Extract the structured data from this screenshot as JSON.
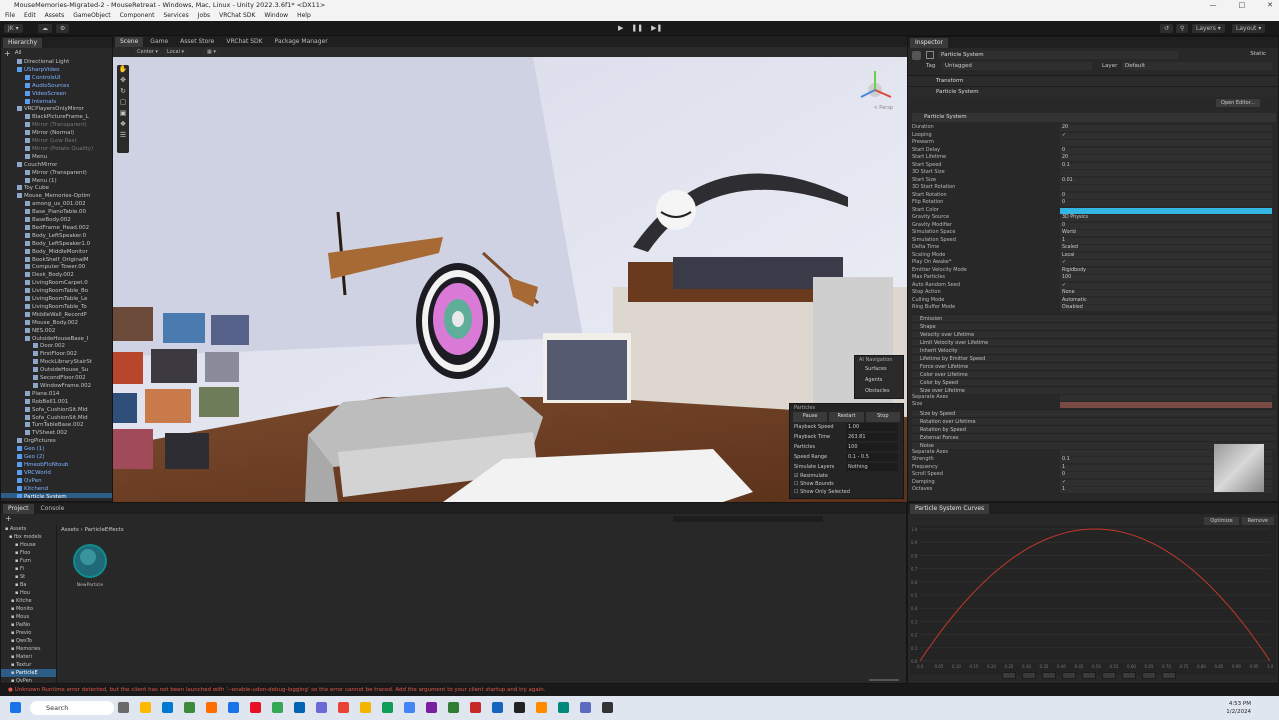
{
  "window": {
    "title": "MouseMemories-Migrated-2 - MouseRetreat - Windows, Mac, Linux - Unity 2022.3.6f1* <DX11>"
  },
  "menu": [
    "File",
    "Edit",
    "Assets",
    "GameObject",
    "Component",
    "Services",
    "Jobs",
    "VRChat SDK",
    "Window",
    "Help"
  ],
  "toolbar": {
    "account": "JK",
    "layers": "Layers",
    "layout": "Layout"
  },
  "hierarchy": {
    "tab": "Hierarchy",
    "search_label": "All",
    "items": [
      {
        "label": "Directional Light",
        "indent": 2,
        "style": "normal"
      },
      {
        "label": "USharpVideo",
        "indent": 2,
        "style": "blue"
      },
      {
        "label": "ControlsUI",
        "indent": 4,
        "style": "blue"
      },
      {
        "label": "AudioSources",
        "indent": 4,
        "style": "blue"
      },
      {
        "label": "VideoScreen",
        "indent": 4,
        "style": "blue"
      },
      {
        "label": "Internals",
        "indent": 4,
        "style": "blue"
      },
      {
        "label": "VRCPlayersOnlyMirror",
        "indent": 2,
        "style": "normal"
      },
      {
        "label": "BlackPictureFrame_L",
        "indent": 4,
        "style": "normal"
      },
      {
        "label": "Mirror (Transparent)",
        "indent": 4,
        "style": "dim"
      },
      {
        "label": "Mirror (Normal)",
        "indent": 4,
        "style": "normal"
      },
      {
        "label": "Mirror (Low Res)",
        "indent": 4,
        "style": "dim"
      },
      {
        "label": "Mirror (Potato Quality)",
        "indent": 4,
        "style": "dim"
      },
      {
        "label": "Menu",
        "indent": 4,
        "style": "normal"
      },
      {
        "label": "CouchMirror",
        "indent": 2,
        "style": "normal"
      },
      {
        "label": "Mirror (Transparent)",
        "indent": 4,
        "style": "normal"
      },
      {
        "label": "Menu (1)",
        "indent": 4,
        "style": "normal"
      },
      {
        "label": "Toy Cube",
        "indent": 2,
        "style": "normal"
      },
      {
        "label": "Mouse_Memories-Optim",
        "indent": 2,
        "style": "normal"
      },
      {
        "label": "among_us_001.002",
        "indent": 4,
        "style": "normal"
      },
      {
        "label": "Base_PianoTable.00",
        "indent": 4,
        "style": "normal"
      },
      {
        "label": "BaseBody.002",
        "indent": 4,
        "style": "normal"
      },
      {
        "label": "BedFrame_Head.002",
        "indent": 4,
        "style": "normal"
      },
      {
        "label": "Body_LeftSpeaker.0",
        "indent": 4,
        "style": "normal"
      },
      {
        "label": "Body_LeftSpeaker1.0",
        "indent": 4,
        "style": "normal"
      },
      {
        "label": "Body_MiddleMonitor",
        "indent": 4,
        "style": "normal"
      },
      {
        "label": "BookShelf_OriginalM",
        "indent": 4,
        "style": "normal"
      },
      {
        "label": "Computer Tower.00",
        "indent": 4,
        "style": "normal"
      },
      {
        "label": "Desk_Body.002",
        "indent": 4,
        "style": "normal"
      },
      {
        "label": "LivingRoomCarpet.0",
        "indent": 4,
        "style": "normal"
      },
      {
        "label": "LivingRoomTable_Bo",
        "indent": 4,
        "style": "normal"
      },
      {
        "label": "LivingRoomTable_Le",
        "indent": 4,
        "style": "normal"
      },
      {
        "label": "LivingRoomTable_To",
        "indent": 4,
        "style": "normal"
      },
      {
        "label": "MiddleWall_RecordP",
        "indent": 4,
        "style": "normal"
      },
      {
        "label": "Mouse_Body.002",
        "indent": 4,
        "style": "normal"
      },
      {
        "label": "NES.002",
        "indent": 4,
        "style": "normal"
      },
      {
        "label": "OutsideHouseBase_I",
        "indent": 4,
        "style": "normal"
      },
      {
        "label": "Door.002",
        "indent": 6,
        "style": "normal"
      },
      {
        "label": "FirstFloor.002",
        "indent": 6,
        "style": "normal"
      },
      {
        "label": "MockLibraryStairSt",
        "indent": 6,
        "style": "normal"
      },
      {
        "label": "OutsideHouse_Su",
        "indent": 6,
        "style": "normal"
      },
      {
        "label": "SecondFloor.002",
        "indent": 6,
        "style": "normal"
      },
      {
        "label": "WindowFrame.002",
        "indent": 6,
        "style": "normal"
      },
      {
        "label": "Plane.014",
        "indent": 4,
        "style": "normal"
      },
      {
        "label": "RobBell1.001",
        "indent": 4,
        "style": "normal"
      },
      {
        "label": "Sofa_CushionSit.Mid",
        "indent": 4,
        "style": "normal"
      },
      {
        "label": "Sofa_CushionSit.Mid",
        "indent": 4,
        "style": "normal"
      },
      {
        "label": "TurnTableBase.002",
        "indent": 4,
        "style": "normal"
      },
      {
        "label": "TVSheet.002",
        "indent": 4,
        "style": "normal"
      },
      {
        "label": "OrgPictures",
        "indent": 2,
        "style": "normal"
      },
      {
        "label": "Geo (1)",
        "indent": 2,
        "style": "blue"
      },
      {
        "label": "Geo (2)",
        "indent": 2,
        "style": "blue"
      },
      {
        "label": "HmeobFloNtoub",
        "indent": 2,
        "style": "blue"
      },
      {
        "label": "VRCWorld",
        "indent": 2,
        "style": "blue"
      },
      {
        "label": "QvPen",
        "indent": 2,
        "style": "blue"
      },
      {
        "label": "Kitchend",
        "indent": 2,
        "style": "blue"
      },
      {
        "label": "Particle System",
        "indent": 2,
        "style": "selected"
      }
    ]
  },
  "scene": {
    "tabs": [
      "Scene",
      "Game",
      "Asset Store",
      "VRChat SDK",
      "Package Manager"
    ],
    "active_tab": "Scene",
    "pivot": "Center",
    "space": "Local",
    "persp_label": "< Persp",
    "ai_nav": {
      "title": "AI Navigation",
      "items": [
        "Surfaces",
        "Agents",
        "Obstacles"
      ]
    },
    "particles_overlay": {
      "title": "Particles",
      "buttons": [
        "Pause",
        "Restart",
        "Stop"
      ],
      "rows": [
        {
          "label": "Playback Speed",
          "value": "1.00"
        },
        {
          "label": "Playback Time",
          "value": "263.81"
        },
        {
          "label": "Particles",
          "value": "100"
        },
        {
          "label": "Speed Range",
          "value": "0.1 - 0.5"
        },
        {
          "label": "Simulate Layers",
          "value": "Nothing"
        }
      ],
      "checks": [
        {
          "label": "Resimulate",
          "checked": true
        },
        {
          "label": "Show Bounds",
          "checked": false
        },
        {
          "label": "Show Only Selected",
          "checked": false
        }
      ]
    }
  },
  "inspector": {
    "tab": "Inspector",
    "object_name": "Particle System",
    "static_label": "Static",
    "tag_label": "Tag",
    "tag_value": "Untagged",
    "layer_label": "Layer",
    "layer_value": "Default",
    "components": [
      "Transform",
      "Particle System"
    ],
    "open_editor": "Open Editor...",
    "module_title": "Particle System",
    "main_rows": [
      {
        "label": "Duration",
        "value": "20"
      },
      {
        "label": "Looping",
        "value": "✓"
      },
      {
        "label": "Prewarm",
        "value": ""
      },
      {
        "label": "Start Delay",
        "value": "0"
      },
      {
        "label": "Start Lifetime",
        "value": "20"
      },
      {
        "label": "Start Speed",
        "value": "0.1"
      },
      {
        "label": "3D Start Size",
        "value": ""
      },
      {
        "label": "Start Size",
        "value": "0.01"
      },
      {
        "label": "3D Start Rotation",
        "value": ""
      },
      {
        "label": "Start Rotation",
        "value": "0"
      },
      {
        "label": "Flip Rotation",
        "value": "0"
      },
      {
        "label": "Start Color",
        "value": ""
      },
      {
        "label": "Gravity Source",
        "value": "3D Physics"
      },
      {
        "label": "Gravity Modifier",
        "value": "0"
      },
      {
        "label": "Simulation Space",
        "value": "World"
      },
      {
        "label": "Simulation Speed",
        "value": "1"
      },
      {
        "label": "Delta Time",
        "value": "Scaled"
      },
      {
        "label": "Scaling Mode",
        "value": "Local"
      },
      {
        "label": "Play On Awake*",
        "value": "✓"
      },
      {
        "label": "Emitter Velocity Mode",
        "value": "Rigidbody"
      },
      {
        "label": "Max Particles",
        "value": "100"
      },
      {
        "label": "Auto Random Seed",
        "value": "✓"
      },
      {
        "label": "Stop Action",
        "value": "None"
      },
      {
        "label": "Culling Mode",
        "value": "Automatic"
      },
      {
        "label": "Ring Buffer Mode",
        "value": "Disabled"
      }
    ],
    "modules": [
      "Emission",
      "Shape",
      "Velocity over Lifetime",
      "Limit Velocity over Lifetime",
      "Inherit Velocity",
      "Lifetime by Emitter Speed",
      "Force over Lifetime",
      "Color over Lifetime",
      "Color by Speed",
      "Size over Lifetime"
    ],
    "size_rows": [
      {
        "label": "Separate Axes",
        "value": ""
      },
      {
        "label": "Size",
        "value": ""
      }
    ],
    "modules2": [
      "Size by Speed",
      "Rotation over Lifetime",
      "Rotation by Speed",
      "External Forces",
      "Noise"
    ],
    "noise_rows": [
      {
        "label": "Separate Axes",
        "value": ""
      },
      {
        "label": "Strength",
        "value": "0.1"
      },
      {
        "label": "Frequency",
        "value": "1"
      },
      {
        "label": "Scroll Speed",
        "value": "0"
      },
      {
        "label": "Damping",
        "value": "✓"
      },
      {
        "label": "Octaves",
        "value": "1"
      }
    ]
  },
  "project": {
    "tabs": [
      "Project",
      "Console"
    ],
    "breadcrumb": [
      "Assets",
      "ParticleEffects"
    ],
    "tree": [
      "Assets",
      "fbx models",
      "House",
      "Floo",
      "Furn",
      "Fi",
      "St",
      "Ba",
      "Hou",
      "Kitche",
      "Monito",
      "Mous",
      "PaiNo",
      "Previo",
      "QwsTo",
      "Memories",
      "Materi",
      "Textur",
      "ParticleE",
      "QvPen"
    ],
    "asset_name": "NewParticle"
  },
  "curves": {
    "title": "Particle System Curves",
    "buttons": [
      "Optimize",
      "Remove"
    ],
    "y_labels": [
      "1.0",
      "0.9",
      "0.8",
      "0.7",
      "0.6",
      "0.5",
      "0.4",
      "0.3",
      "0.2",
      "0.1",
      "0.0"
    ],
    "x_labels": [
      "0.0",
      "0.05",
      "0.10",
      "0.15",
      "0.20",
      "0.25",
      "0.30",
      "0.35",
      "0.40",
      "0.45",
      "0.50",
      "0.55",
      "0.60",
      "0.65",
      "0.70",
      "0.75",
      "0.80",
      "0.85",
      "0.90",
      "0.95",
      "1.0"
    ],
    "curve_color": "#c0392b"
  },
  "status": {
    "message": "Unknown Runtime error detected, but the client has not been launched with '--enable-udon-debug-logging' so the error cannot be traced. Add the argument to your client startup and try again."
  },
  "taskbar": {
    "search": "Search",
    "time": "4:53 PM",
    "date": "1/2/2024"
  }
}
